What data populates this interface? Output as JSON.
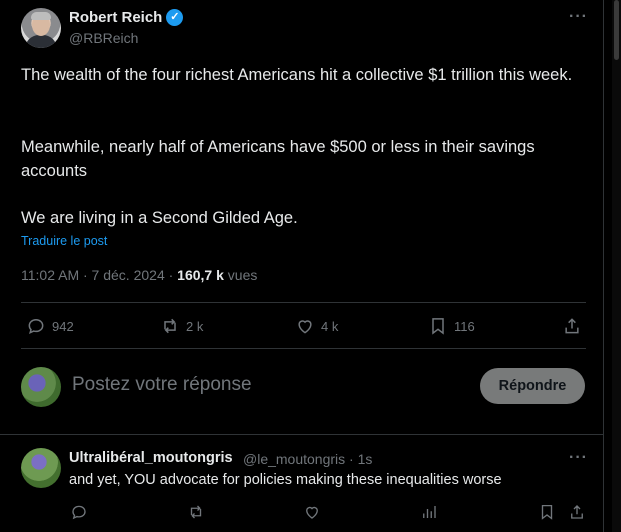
{
  "post": {
    "author_name": "Robert Reich",
    "verified_badge": "✓",
    "author_handle": "@RBReich",
    "more_label": "···",
    "paragraphs": [
      "The wealth of the four richest Americans hit a collective $1 trillion this week.",
      "Meanwhile, nearly half of Americans have $500 or less in their savings accounts",
      "We are living in a Second Gilded Age."
    ],
    "translate_label": "Traduire le post",
    "time": "11:02 AM · 7 déc. 2024 · ",
    "views_count": "160,7 k",
    "views_label": " vues",
    "actions": {
      "replies": "942",
      "reposts": "2 k",
      "likes": "4 k",
      "bookmarks": "116"
    }
  },
  "compose": {
    "placeholder": "Postez votre réponse",
    "reply_button": "Répondre"
  },
  "reply": {
    "author_name": "Ultralibéral_moutongris",
    "author_handle": "@le_moutongris · 1s",
    "more_label": "···",
    "text": "and yet, YOU advocate for policies making these inequalities worse"
  },
  "colors": {
    "background": "#000000",
    "text": "#e7e9ea",
    "muted": "#71767b",
    "accent": "#1d9bf0",
    "divider": "#2f3336"
  }
}
